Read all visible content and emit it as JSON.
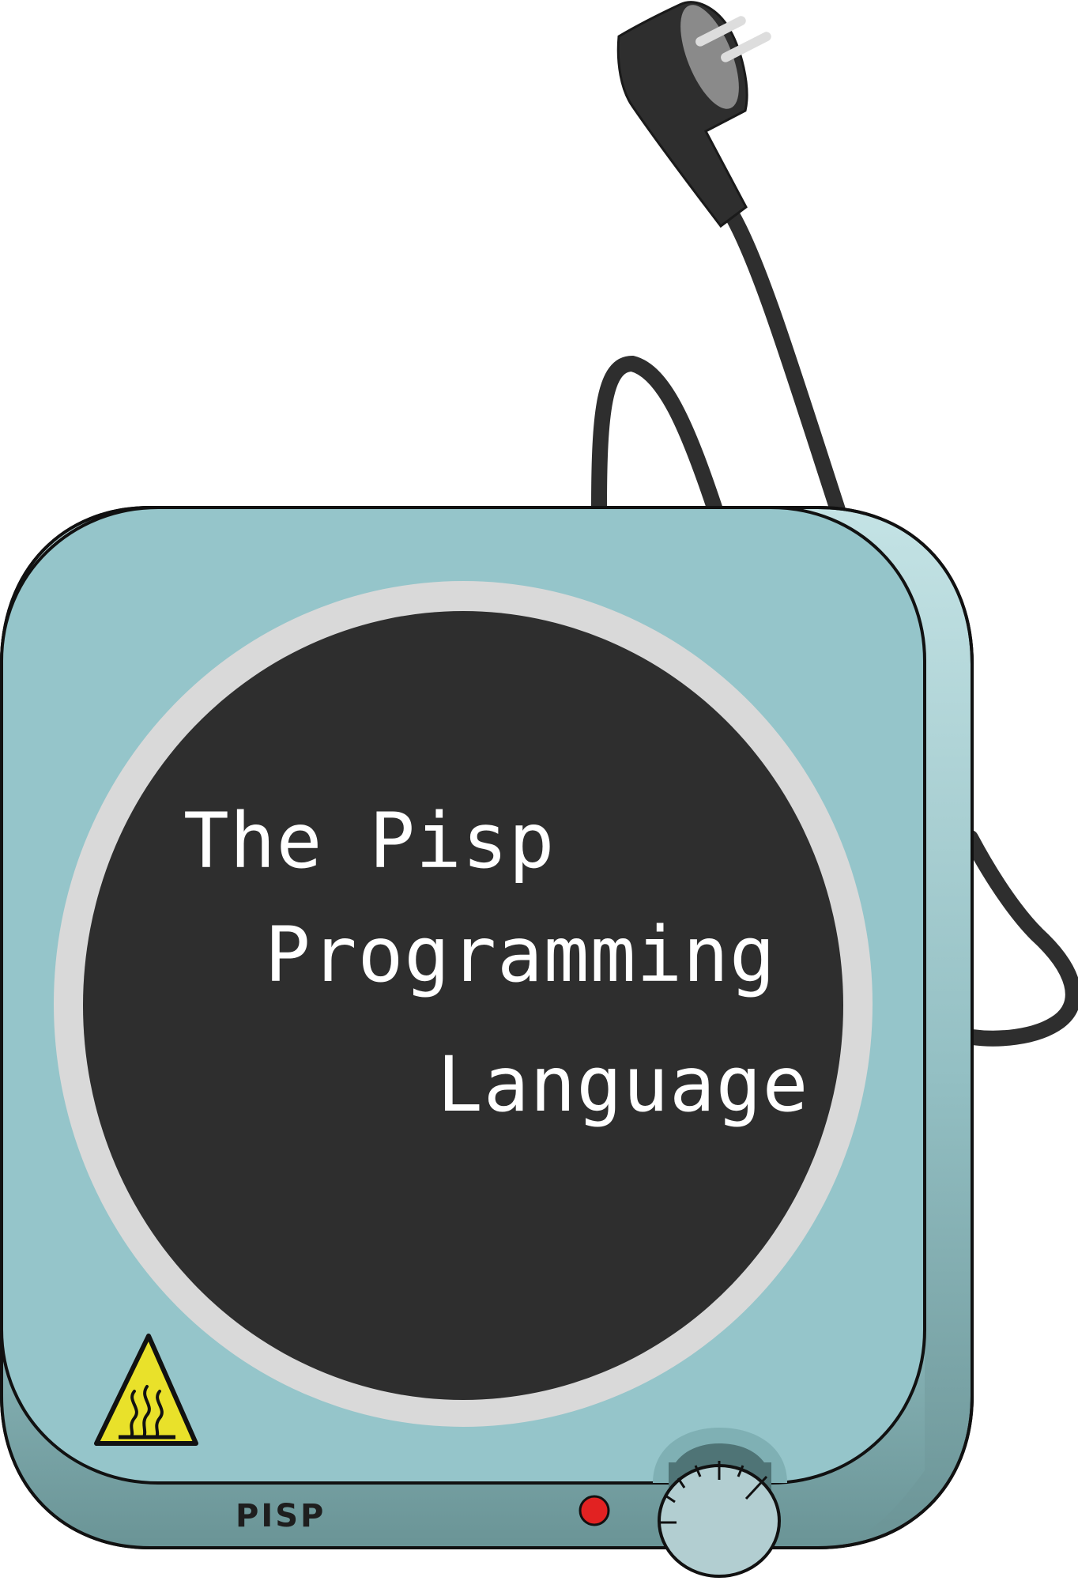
{
  "title": {
    "line1": "The Pisp",
    "line2": "Programming",
    "line3": "Language"
  },
  "device": {
    "brand": "PISP",
    "indicator_state": "on",
    "knob_setting": "high"
  },
  "icons": {
    "warning": "hot-surface-warning-icon",
    "plug": "power-plug-icon"
  },
  "colors": {
    "body_top": "#95c5ca",
    "body_side_top": "#bfe0e2",
    "body_side_bottom": "#6f9a9c",
    "burner": "#2e2e2e",
    "burner_ring": "#d9d9d9",
    "cord": "#2e2e2e",
    "indicator": "#e22222",
    "warning_fill": "#e9e12a"
  }
}
